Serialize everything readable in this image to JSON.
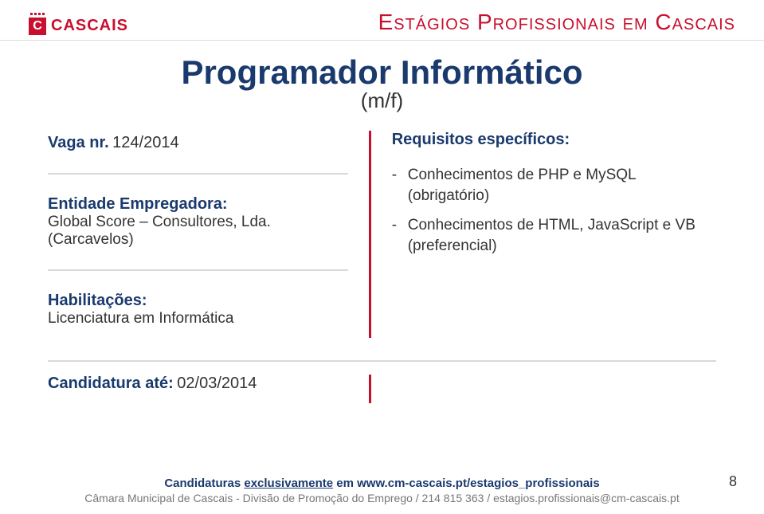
{
  "brand": {
    "name": "CASCAIS",
    "logo_letter": "C"
  },
  "program_title": "Estágios Profissionais em Cascais",
  "job": {
    "title": "Programador Informático",
    "subtitle": "(m/f)"
  },
  "vacancy": {
    "label": "Vaga nr.",
    "number": "124/2014"
  },
  "employer": {
    "label": "Entidade Empregadora:",
    "name": "Global Score – Consultores, Lda.",
    "location": "(Carcavelos)"
  },
  "qualifications": {
    "label": "Habilitações:",
    "value": "Licenciatura em Informática"
  },
  "requirements": {
    "label": "Requisitos específicos:",
    "items": [
      "Conhecimentos de PHP e MySQL (obrigatório)",
      "Conhecimentos de HTML, JavaScript e VB (preferencial)"
    ]
  },
  "deadline": {
    "label": "Candidatura até:",
    "date": "02/03/2014"
  },
  "footer": {
    "line1_prefix": "Candidaturas ",
    "line1_underline": "exclusivamente",
    "line1_mid": " em ",
    "line1_link": "www.cm-cascais.pt/estagios_profissionais",
    "line2": "Câmara Municipal de Cascais - Divisão de Promoção do Emprego / 214 815 363 / estagios.profissionais@cm-cascais.pt"
  },
  "page_number": "8"
}
